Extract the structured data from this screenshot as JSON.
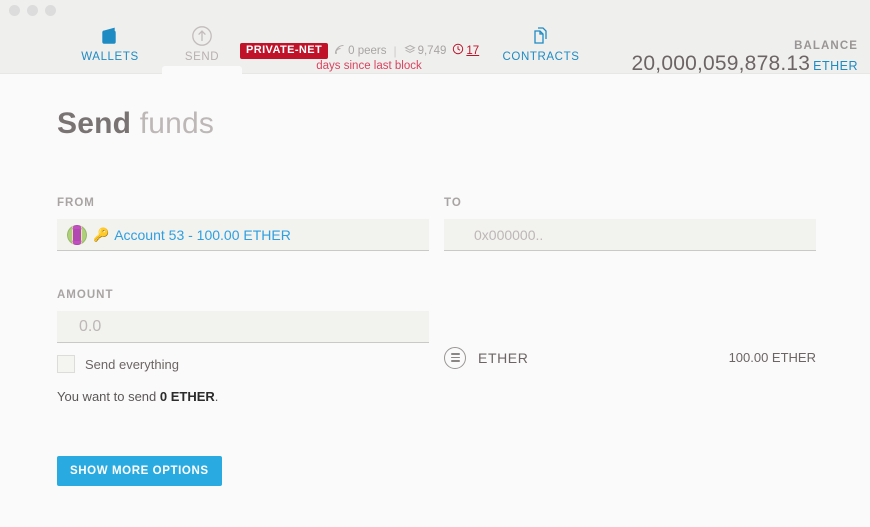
{
  "window": {
    "dots": [
      "close",
      "minimize",
      "maximize"
    ]
  },
  "header": {
    "tabs": [
      {
        "id": "wallets",
        "label": "WALLETS",
        "icon": "wallet-icon",
        "active": false
      },
      {
        "id": "send",
        "label": "SEND",
        "icon": "send-arrow-icon",
        "active": true
      },
      {
        "id": "contracts",
        "label": "CONTRACTS",
        "icon": "contracts-icon",
        "active": false
      }
    ],
    "network": {
      "badge": "PRIVATE-NET",
      "peers": "0 peers",
      "separator": "|",
      "blocks": "9,749",
      "last_block_time": "17",
      "last_block_message": "days since last block",
      "peers_icon": "signal-icon",
      "blocks_icon": "blocks-icon",
      "clock_icon": "clock-icon"
    },
    "balance": {
      "caption": "BALANCE",
      "amount": "20,000,059,878.13",
      "unit": "ETHER"
    }
  },
  "page": {
    "title_bold": "Send",
    "title_light": " funds"
  },
  "form": {
    "from": {
      "label": "FROM",
      "account_icon": "identicon",
      "key_icon": "key-icon",
      "value": "Account 53 - 100.00 ETHER"
    },
    "to": {
      "label": "TO",
      "placeholder": "0x000000..",
      "value": ""
    },
    "amount": {
      "label": "AMOUNT",
      "placeholder": "0.0",
      "value": ""
    },
    "currency": {
      "icon": "ether-icon",
      "name": "ETHER",
      "balance": "100.00 ETHER"
    },
    "send_everything": {
      "label": "Send everything",
      "checked": false
    },
    "summary_prefix": "You want to send ",
    "summary_amount": "0 ETHER",
    "summary_suffix": ".",
    "submit_label": "SHOW MORE OPTIONS"
  },
  "colors": {
    "accent_blue": "#29abe2",
    "link_blue": "#1e8bc3",
    "badge_red": "#c0132a",
    "alert_red": "#d9445f",
    "header_bg": "#efefee",
    "body_bg": "#fafafa"
  }
}
